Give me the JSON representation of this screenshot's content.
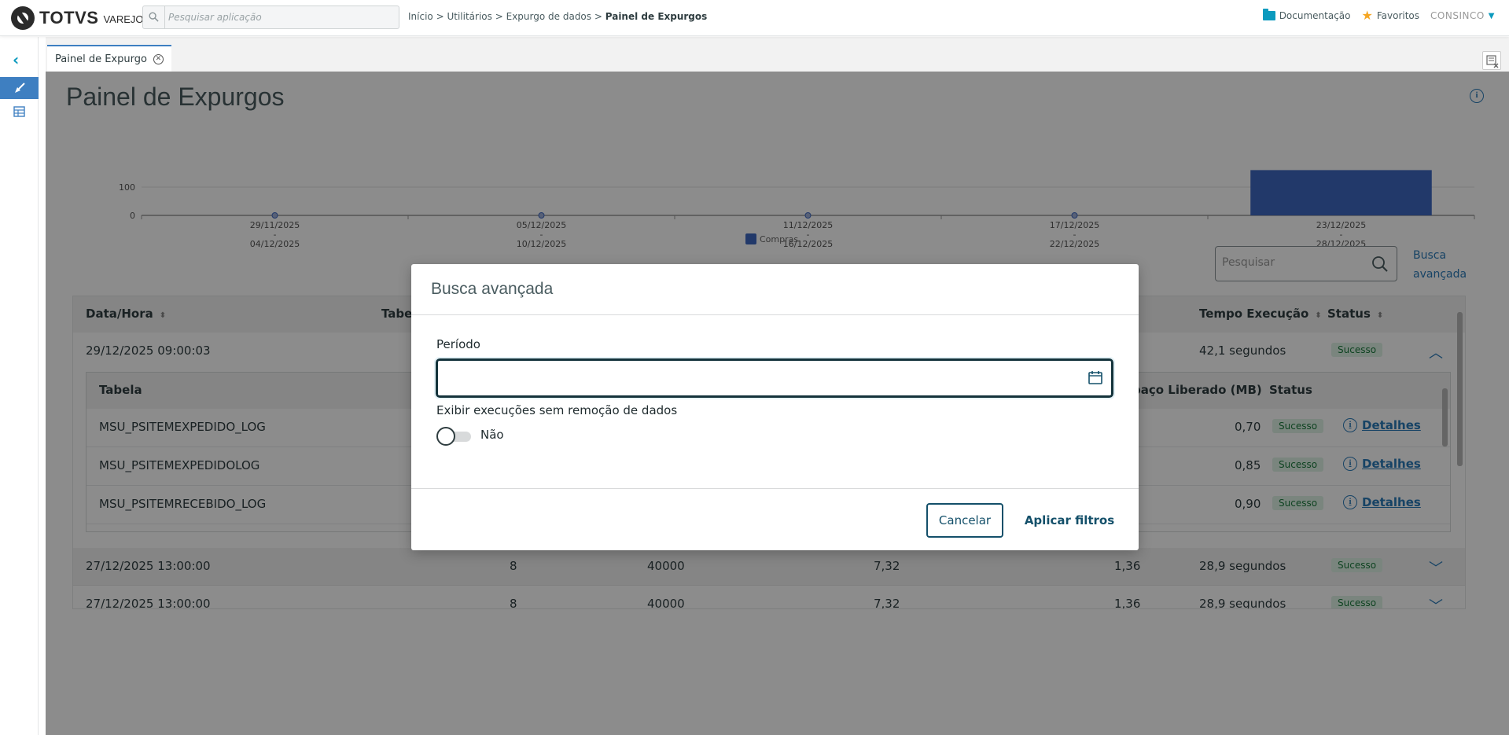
{
  "header": {
    "logo_text": "TOTVS",
    "logo_sub": "VAREJO",
    "search_placeholder": "Pesquisar aplicação",
    "breadcrumb": {
      "items": [
        "Início",
        "Utilitários",
        "Expurgo de dados"
      ],
      "sep": ">",
      "current": "Painel de Expurgos"
    },
    "documentation_label": "Documentação",
    "favorites_label": "Favoritos",
    "company_label": "CONSINCO"
  },
  "tab": {
    "label": "Painel de Expurgo"
  },
  "page": {
    "title": "Painel de Expurgos",
    "search_placeholder": "Pesquisar",
    "advanced_search_label": "Busca avançada"
  },
  "chart_data": {
    "type": "bar",
    "categories": [
      [
        "29/11/2025",
        "-",
        "04/12/2025"
      ],
      [
        "05/12/2025",
        "-",
        "10/12/2025"
      ],
      [
        "11/12/2025",
        "-",
        "16/12/2025"
      ],
      [
        "17/12/2025",
        "-",
        "22/12/2025"
      ],
      [
        "23/12/2025",
        "-",
        "28/12/2025"
      ]
    ],
    "series": [
      {
        "name": "Compras",
        "values": [
          0,
          0,
          0,
          0,
          160
        ],
        "color": "#3e69c2"
      }
    ],
    "yticks": [
      0,
      100
    ],
    "ylim": [
      0,
      170
    ],
    "legend_position": "bottom"
  },
  "table": {
    "columns": [
      "Data/Hora",
      "Tabel",
      "Tempo Execução",
      "Status"
    ],
    "rows": [
      {
        "datetime": "29/12/2025 09:00:03",
        "tempo": "42,1 segundos",
        "status": "Sucesso",
        "expanded": true
      },
      {
        "datetime": "27/12/2025 13:00:00",
        "tabelas": "8",
        "registros": "40000",
        "espaco1": "7,32",
        "espaco2": "1,36",
        "tempo": "28,9 segundos",
        "status": "Sucesso"
      },
      {
        "datetime": "27/12/2025 13:00:00",
        "tabelas": "8",
        "registros": "40000",
        "espaco1": "7,32",
        "espaco2": "1,36",
        "tempo": "28,9 segundos",
        "status": "Sucesso"
      }
    ],
    "inner": {
      "columns": [
        "Tabela",
        "paço Liberado (MB)",
        "Status"
      ],
      "rows": [
        {
          "tabela": "MSU_PSITEMEXPEDIDO_LOG",
          "espaco": "0,70",
          "status": "Sucesso",
          "details": "Detalhes"
        },
        {
          "tabela": "MSU_PSITEMEXPEDIDOLOG",
          "espaco": "0,85",
          "status": "Sucesso",
          "details": "Detalhes"
        },
        {
          "tabela": "MSU_PSITEMRECEBIDO_LOG",
          "espaco": "0,90",
          "status": "Sucesso",
          "details": "Detalhes"
        }
      ]
    }
  },
  "modal": {
    "title": "Busca avançada",
    "period_label": "Período",
    "period_value": "",
    "show_label": "Exibir execuções sem remoção de dados",
    "toggle_value": "Não",
    "cancel_label": "Cancelar",
    "apply_label": "Aplicar filtros"
  }
}
